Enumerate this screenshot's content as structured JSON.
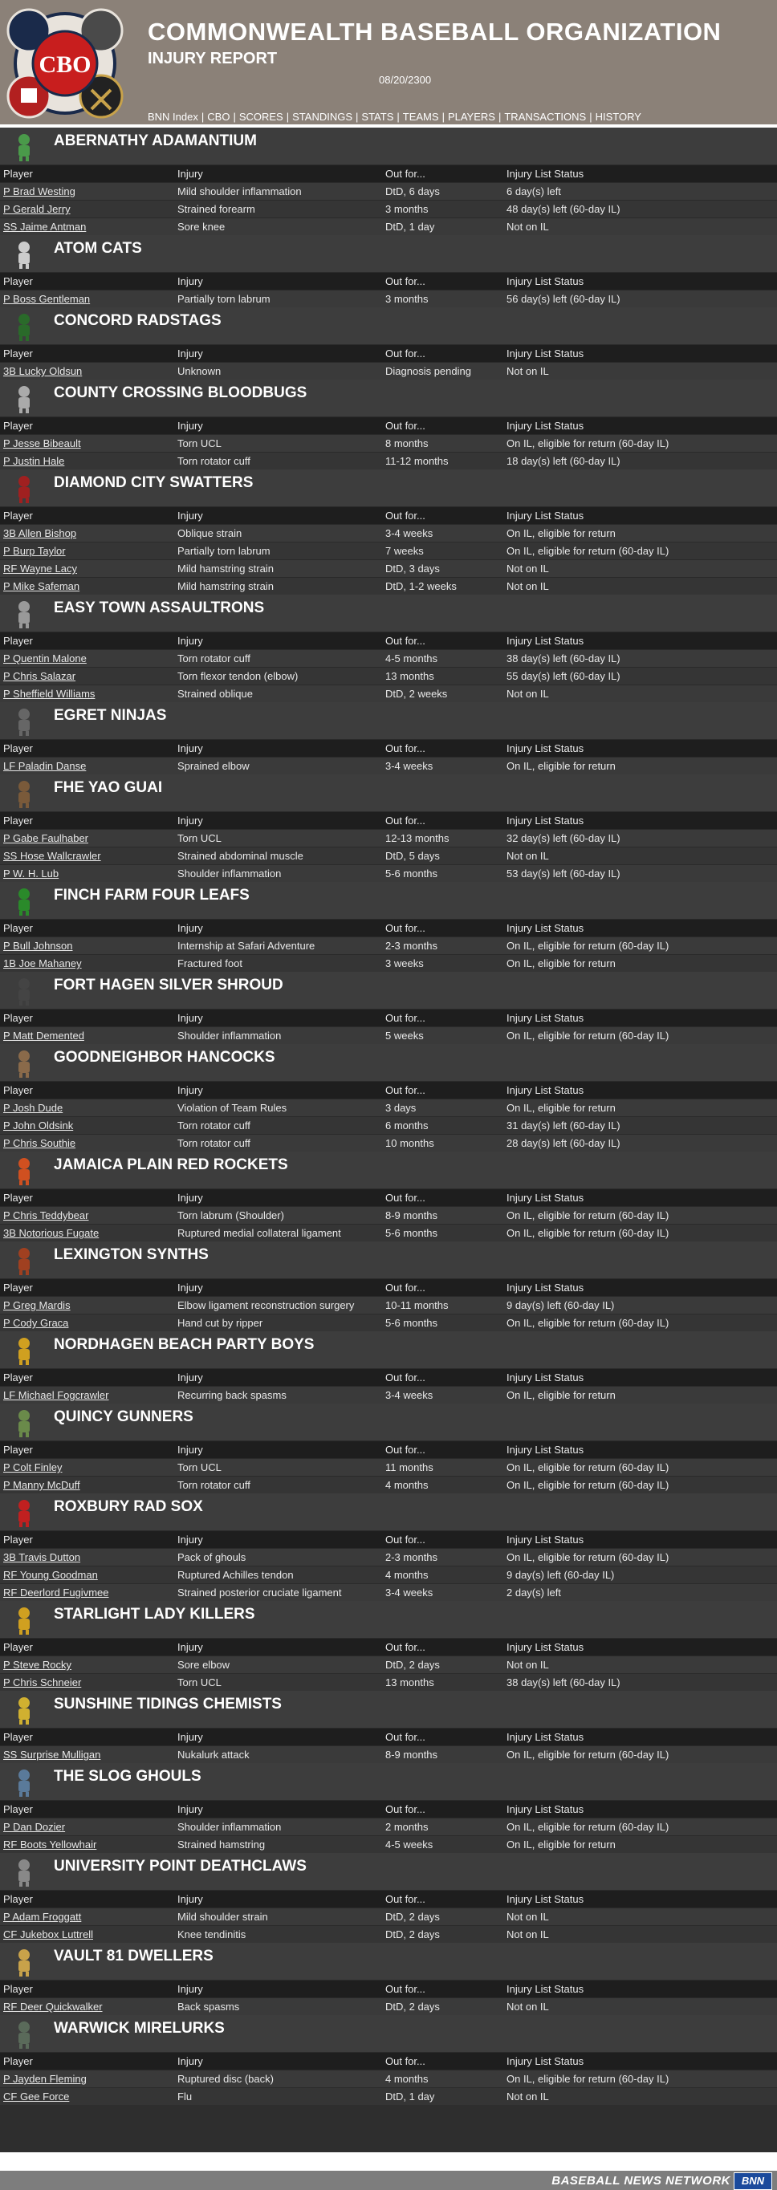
{
  "header": {
    "org_title": "COMMONWEALTH BASEBALL ORGANIZATION",
    "report_title": "INJURY REPORT",
    "date": "08/20/2300",
    "logo_text": "CBO"
  },
  "nav": [
    "BNN Index",
    "CBO",
    "SCORES",
    "STANDINGS",
    "STATS",
    "TEAMS",
    "PLAYERS",
    "TRANSACTIONS",
    "HISTORY"
  ],
  "columns": [
    "Player",
    "Injury",
    "Out for...",
    "Injury List Status"
  ],
  "teams": [
    {
      "name": "ABERNATHY ADAMANTIUM",
      "icon": "vault-boy-icon",
      "rows": [
        [
          "P Brad Westing",
          "Mild shoulder inflammation",
          "DtD, 6 days",
          "6 day(s) left"
        ],
        [
          "P Gerald Jerry",
          "Strained forearm",
          "3 months",
          "48 day(s) left (60-day IL)"
        ],
        [
          "SS Jaime Antman",
          "Sore knee",
          "DtD, 1 day",
          "Not on IL"
        ]
      ]
    },
    {
      "name": "ATOM CATS",
      "icon": "cat-icon",
      "rows": [
        [
          "P Boss Gentleman",
          "Partially torn labrum",
          "3 months",
          "56 day(s) left (60-day IL)"
        ]
      ]
    },
    {
      "name": "CONCORD RADSTAGS",
      "icon": "radstag-icon",
      "rows": [
        [
          "3B Lucky Oldsun",
          "Unknown",
          "Diagnosis pending",
          "Not on IL"
        ]
      ]
    },
    {
      "name": "COUNTY CROSSING BLOODBUGS",
      "icon": "bloodbug-icon",
      "rows": [
        [
          "P Jesse Bibeault",
          "Torn UCL",
          "8 months",
          "On IL, eligible for return (60-day IL)"
        ],
        [
          "P Justin Hale",
          "Torn rotator cuff",
          "11-12 months",
          "18 day(s) left (60-day IL)"
        ]
      ]
    },
    {
      "name": "DIAMOND CITY SWATTERS",
      "icon": "swatter-icon",
      "rows": [
        [
          "3B Allen Bishop",
          "Oblique strain",
          "3-4 weeks",
          "On IL, eligible for return"
        ],
        [
          "P Burp Taylor",
          "Partially torn labrum",
          "7 weeks",
          "On IL, eligible for return (60-day IL)"
        ],
        [
          "RF Wayne Lacy",
          "Mild hamstring strain",
          "DtD, 3 days",
          "Not on IL"
        ],
        [
          "P Mike Safeman",
          "Mild hamstring strain",
          "DtD, 1-2 weeks",
          "Not on IL"
        ]
      ]
    },
    {
      "name": "EASY TOWN ASSAULTRONS",
      "icon": "assaultron-icon",
      "rows": [
        [
          "P Quentin Malone",
          "Torn rotator cuff",
          "4-5 months",
          "38 day(s) left (60-day IL)"
        ],
        [
          "P Chris Salazar",
          "Torn flexor tendon (elbow)",
          "13 months",
          "55 day(s) left (60-day IL)"
        ],
        [
          "P Sheffield Williams",
          "Strained oblique",
          "DtD, 2 weeks",
          "Not on IL"
        ]
      ]
    },
    {
      "name": "EGRET NINJAS",
      "icon": "ninja-icon",
      "rows": [
        [
          "LF Paladin Danse",
          "Sprained elbow",
          "3-4 weeks",
          "On IL, eligible for return"
        ]
      ]
    },
    {
      "name": "FHE YAO GUAI",
      "icon": "yao-guai-icon",
      "rows": [
        [
          "P Gabe Faulhaber",
          "Torn UCL",
          "12-13 months",
          "32 day(s) left (60-day IL)"
        ],
        [
          "SS Hose Wallcrawler",
          "Strained abdominal muscle",
          "DtD, 5 days",
          "Not on IL"
        ],
        [
          "P W. H. Lub",
          "Shoulder inflammation",
          "5-6 months",
          "53 day(s) left (60-day IL)"
        ]
      ]
    },
    {
      "name": "FINCH FARM FOUR LEAFS",
      "icon": "four-leaf-icon",
      "rows": [
        [
          "P Bull Johnson",
          "Internship at Safari Adventure",
          "2-3 months",
          "On IL, eligible for return (60-day IL)"
        ],
        [
          "1B Joe Mahaney",
          "Fractured foot",
          "3 weeks",
          "On IL, eligible for return"
        ]
      ]
    },
    {
      "name": "FORT HAGEN SILVER SHROUD",
      "icon": "silver-shroud-icon",
      "rows": [
        [
          "P Matt Demented",
          "Shoulder inflammation",
          "5 weeks",
          "On IL, eligible for return (60-day IL)"
        ]
      ]
    },
    {
      "name": "GOODNEIGHBOR HANCOCKS",
      "icon": "hancock-icon",
      "rows": [
        [
          "P Josh Dude",
          "Violation of Team Rules",
          "3 days",
          "On IL, eligible for return"
        ],
        [
          "P John Oldsink",
          "Torn rotator cuff",
          "6 months",
          "31 day(s) left (60-day IL)"
        ],
        [
          "P Chris Southie",
          "Torn rotator cuff",
          "10 months",
          "28 day(s) left (60-day IL)"
        ]
      ]
    },
    {
      "name": "JAMAICA PLAIN RED ROCKETS",
      "icon": "rocket-icon",
      "rows": [
        [
          "P Chris Teddybear",
          "Torn labrum (Shoulder)",
          "8-9 months",
          "On IL, eligible for return (60-day IL)"
        ],
        [
          "3B Notorious Fugate",
          "Ruptured medial collateral ligament",
          "5-6 months",
          "On IL, eligible for return (60-day IL)"
        ]
      ]
    },
    {
      "name": "LEXINGTON SYNTHS",
      "icon": "synth-icon",
      "rows": [
        [
          "P Greg Mardis",
          "Elbow ligament reconstruction surgery",
          "10-11 months",
          "9 day(s) left (60-day IL)"
        ],
        [
          "P Cody Graca",
          "Hand cut by ripper",
          "5-6 months",
          "On IL, eligible for return (60-day IL)"
        ]
      ]
    },
    {
      "name": "NORDHAGEN BEACH PARTY BOYS",
      "icon": "party-boy-icon",
      "rows": [
        [
          "LF Michael Fogcrawler",
          "Recurring back spasms",
          "3-4 weeks",
          "On IL, eligible for return"
        ]
      ]
    },
    {
      "name": "QUINCY GUNNERS",
      "icon": "gunner-icon",
      "rows": [
        [
          "P Colt Finley",
          "Torn UCL",
          "11 months",
          "On IL, eligible for return (60-day IL)"
        ],
        [
          "P Manny McDuff",
          "Torn rotator cuff",
          "4 months",
          "On IL, eligible for return (60-day IL)"
        ]
      ]
    },
    {
      "name": "ROXBURY RAD SOX",
      "icon": "r-letter-icon",
      "rows": [
        [
          "3B Travis Dutton",
          "Pack of ghouls",
          "2-3 months",
          "On IL, eligible for return (60-day IL)"
        ],
        [
          "RF Young Goodman",
          "Ruptured Achilles tendon",
          "4 months",
          "9 day(s) left (60-day IL)"
        ],
        [
          "RF Deerlord Fugivmee",
          "Strained posterior cruciate ligament",
          "3-4 weeks",
          "2 day(s) left"
        ]
      ]
    },
    {
      "name": "STARLIGHT LADY KILLERS",
      "icon": "lady-killer-icon",
      "rows": [
        [
          "P Steve Rocky",
          "Sore elbow",
          "DtD, 2 days",
          "Not on IL"
        ],
        [
          "P Chris Schneier",
          "Torn UCL",
          "13 months",
          "38 day(s) left (60-day IL)"
        ]
      ]
    },
    {
      "name": "SUNSHINE TIDINGS CHEMISTS",
      "icon": "chemist-icon",
      "rows": [
        [
          "SS Surprise Mulligan",
          "Nukalurk attack",
          "8-9 months",
          "On IL, eligible for return (60-day IL)"
        ]
      ]
    },
    {
      "name": "THE SLOG GHOULS",
      "icon": "ghoul-icon",
      "rows": [
        [
          "P Dan Dozier",
          "Shoulder inflammation",
          "2 months",
          "On IL, eligible for return (60-day IL)"
        ],
        [
          "RF Boots Yellowhair",
          "Strained hamstring",
          "4-5 weeks",
          "On IL, eligible for return"
        ]
      ]
    },
    {
      "name": "UNIVERSITY POINT DEATHCLAWS",
      "icon": "deathclaw-icon",
      "rows": [
        [
          "P Adam Froggatt",
          "Mild shoulder strain",
          "DtD, 2 days",
          "Not on IL"
        ],
        [
          "CF Jukebox Luttrell",
          "Knee tendinitis",
          "DtD, 2 days",
          "Not on IL"
        ]
      ]
    },
    {
      "name": "VAULT 81 DWELLERS",
      "icon": "vault-gear-icon",
      "rows": [
        [
          "RF Deer Quickwalker",
          "Back spasms",
          "DtD, 2 days",
          "Not on IL"
        ]
      ]
    },
    {
      "name": "WARWICK MIRELURKS",
      "icon": "mirelurk-icon",
      "rows": [
        [
          "P Jayden Fleming",
          "Ruptured disc (back)",
          "4 months",
          "On IL, eligible for return (60-day IL)"
        ],
        [
          "CF Gee Force",
          "Flu",
          "DtD, 1 day",
          "Not on IL"
        ]
      ]
    }
  ],
  "footer": {
    "text": "BASEBALL NEWS NETWORK",
    "logo_text": "BNN"
  }
}
